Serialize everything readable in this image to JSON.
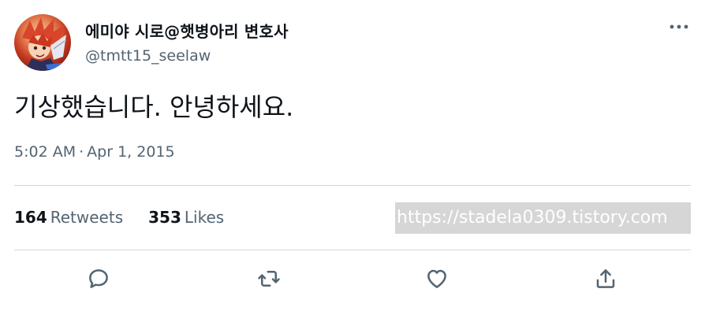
{
  "tweet": {
    "author": {
      "display_name": "에미야 시로@햇병아리 변호사",
      "handle": "@tmtt15_seelaw"
    },
    "text": "기상했습니다. 안녕하세요.",
    "time": "5:02 AM",
    "separator": "·",
    "date": "Apr 1, 2015",
    "stats": {
      "retweets_count": "164",
      "retweets_label": "Retweets",
      "likes_count": "353",
      "likes_label": "Likes"
    }
  },
  "watermark": "https://stadela0309.tistory.com",
  "icons": {
    "more": "more-horizontal-icon",
    "reply": "reply-icon",
    "retweet": "retweet-icon",
    "like": "heart-icon",
    "share": "share-icon"
  },
  "colors": {
    "text_primary": "#0f1419",
    "text_secondary": "#536471",
    "divider": "#cfd9de",
    "watermark_bg": "#d6d6d6"
  }
}
